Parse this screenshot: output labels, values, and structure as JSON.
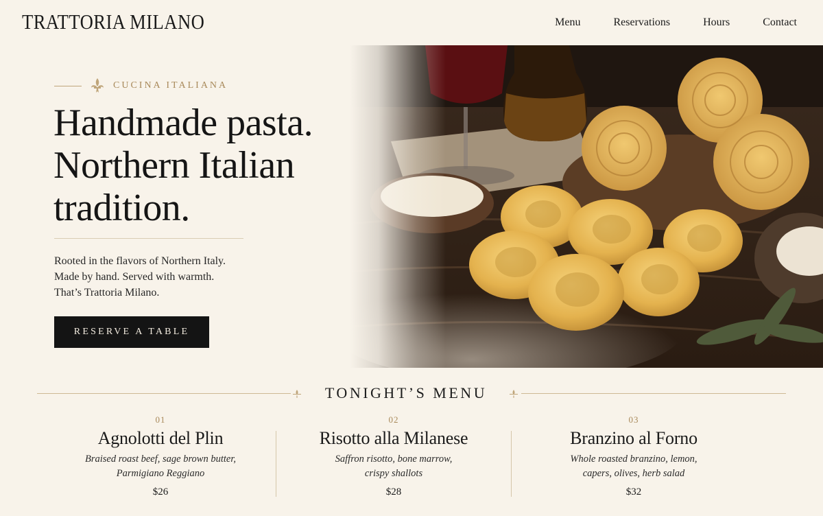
{
  "brand": {
    "name": "TRATTORIA MILANO"
  },
  "nav": [
    {
      "label": "Menu"
    },
    {
      "label": "Reservations"
    },
    {
      "label": "Hours"
    },
    {
      "label": "Contact"
    }
  ],
  "hero": {
    "eyebrow": "CUCINA ITALIANA",
    "headline": [
      "Handmade pasta.",
      "Northern Italian",
      "tradition."
    ],
    "intro": [
      "Rooted in the flavors of Northern Italy.",
      "Made by hand. Served with warmth.",
      "That’s Trattoria Milano."
    ],
    "cta_label": "RESERVE A TABLE"
  },
  "menu": {
    "title": "TONIGHT’S MENU",
    "dishes": [
      {
        "number": "01",
        "name": "Agnolotti del Plin",
        "desc_lines": [
          "Braised roast beef, sage brown butter,",
          "Parmigiano Reggiano"
        ],
        "price": "$26"
      },
      {
        "number": "02",
        "name": "Risotto alla Milanese",
        "desc_lines": [
          "Saffron risotto, bone marrow,",
          "crispy shallots"
        ],
        "price": "$28"
      },
      {
        "number": "03",
        "name": "Branzino al Forno",
        "desc_lines": [
          "Whole roasted branzino, lemon,",
          "capers, olives, herb salad"
        ],
        "price": "$32"
      }
    ]
  },
  "colors": {
    "background": "#f8f3ea",
    "accent_gold": "#a8895a",
    "button_dark": "#141414"
  },
  "icons": [
    "fleur-de-lis-icon",
    "menu-ornament-icon"
  ]
}
